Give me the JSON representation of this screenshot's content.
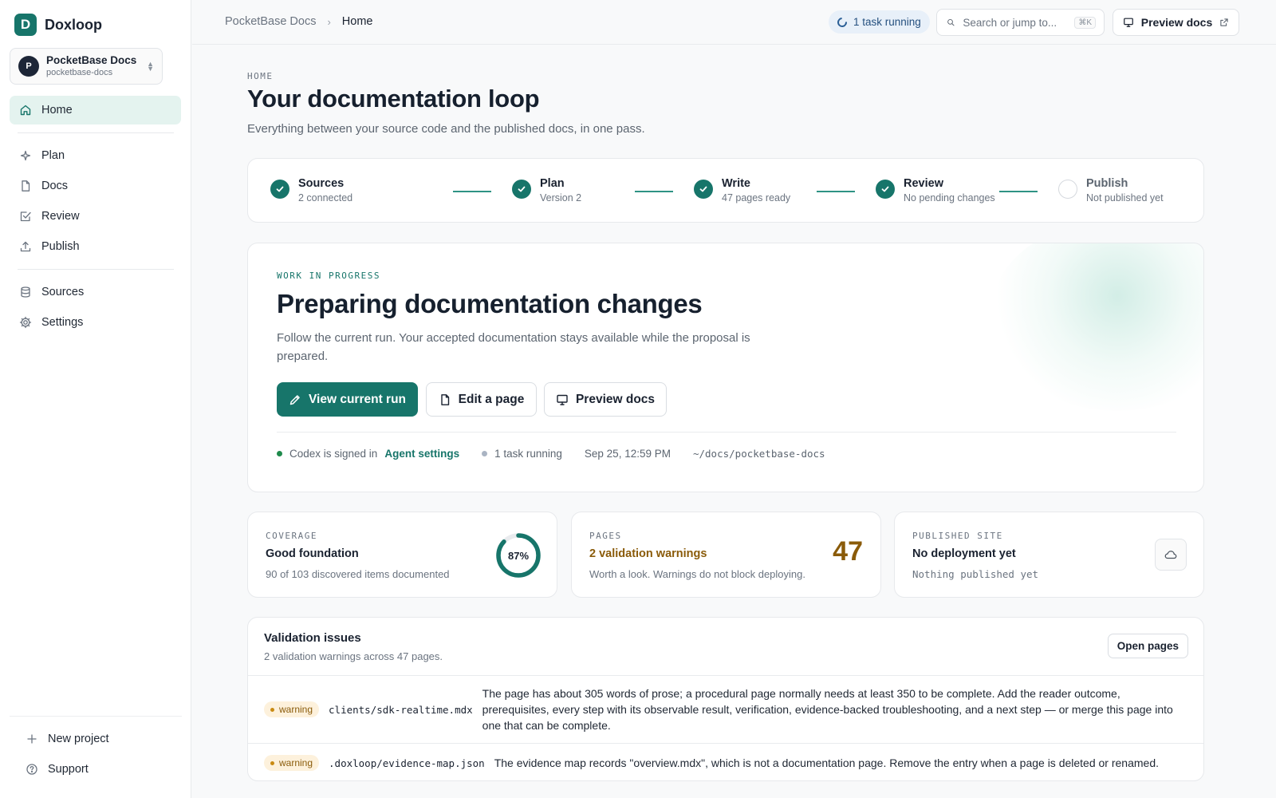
{
  "brand": {
    "logo_letter": "D",
    "name": "Doxloop"
  },
  "project": {
    "avatar": "P",
    "name": "PocketBase Docs",
    "slug": "pocketbase-docs"
  },
  "nav": [
    {
      "id": "home",
      "label": "Home",
      "icon": "home-icon",
      "active": true
    },
    {
      "id": "plan",
      "label": "Plan",
      "icon": "sparkle-icon"
    },
    {
      "id": "docs",
      "label": "Docs",
      "icon": "file-icon"
    },
    {
      "id": "review",
      "label": "Review",
      "icon": "check-square-icon"
    },
    {
      "id": "publish",
      "label": "Publish",
      "icon": "upload-icon"
    },
    {
      "id": "sources",
      "label": "Sources",
      "icon": "database-icon"
    },
    {
      "id": "settings",
      "label": "Settings",
      "icon": "gear-icon"
    }
  ],
  "sidebar_bottom": [
    {
      "label": "New project",
      "icon": "plus-icon"
    },
    {
      "label": "Support",
      "icon": "help-circle-icon"
    }
  ],
  "topbar": {
    "breadcrumb_root": "PocketBase Docs",
    "breadcrumb_current": "Home",
    "task_status": "1 task running",
    "search_placeholder": "Search or jump to...",
    "search_shortcut": "⌘K",
    "preview_label": "Preview docs"
  },
  "header": {
    "eyebrow": "HOME",
    "title": "Your documentation loop",
    "subtitle": "Everything between your source code and the published docs, in one pass."
  },
  "steps": [
    {
      "label": "Sources",
      "sub": "2 connected",
      "done": true
    },
    {
      "label": "Plan",
      "sub": "Version 2",
      "done": true
    },
    {
      "label": "Write",
      "sub": "47 pages ready",
      "done": true
    },
    {
      "label": "Review",
      "sub": "No pending changes",
      "done": true
    },
    {
      "label": "Publish",
      "sub": "Not published yet",
      "done": false
    }
  ],
  "hero": {
    "eyebrow": "WORK IN PROGRESS",
    "title": "Preparing documentation changes",
    "description": "Follow the current run. Your accepted documentation stays available while the proposal is prepared.",
    "primary_button": "View current run",
    "edit_button": "Edit a page",
    "preview_button": "Preview docs",
    "agent_status": "Codex is signed in",
    "agent_link": "Agent settings",
    "task_status": "1 task running",
    "timestamp": "Sep 25, 12:59 PM",
    "path": "~/docs/pocketbase-docs",
    "colors": {
      "accent": "#17756a",
      "agent_dot": "#1f8a4c",
      "task_dot": "#aab4c3"
    }
  },
  "stats": {
    "coverage": {
      "eyebrow": "COVERAGE",
      "title": "Good foundation",
      "sub": "90 of 103 discovered items documented",
      "percent_label": "87%",
      "percent": 87
    },
    "pages": {
      "eyebrow": "PAGES",
      "title": "2 validation warnings",
      "sub": "Worth a look. Warnings do not block deploying.",
      "count": "47"
    },
    "published": {
      "eyebrow": "PUBLISHED SITE",
      "title": "No deployment yet",
      "sub": "Nothing published yet"
    }
  },
  "validation": {
    "title": "Validation issues",
    "subtitle": "2 validation warnings across 47 pages.",
    "open_button": "Open pages",
    "issues": [
      {
        "level": "warning",
        "file": "clients/sdk-realtime.mdx",
        "message": "The page has about 305 words of prose; a procedural page normally needs at least 350 to be complete. Add the reader outcome, prerequisites, every step with its observable result, verification, evidence-backed troubleshooting, and a next step — or merge this page into one that can be complete."
      },
      {
        "level": "warning",
        "file": ".doxloop/evidence-map.json",
        "message": "The evidence map records \"overview.mdx\", which is not a documentation page. Remove the entry when a page is deleted or renamed."
      }
    ]
  }
}
